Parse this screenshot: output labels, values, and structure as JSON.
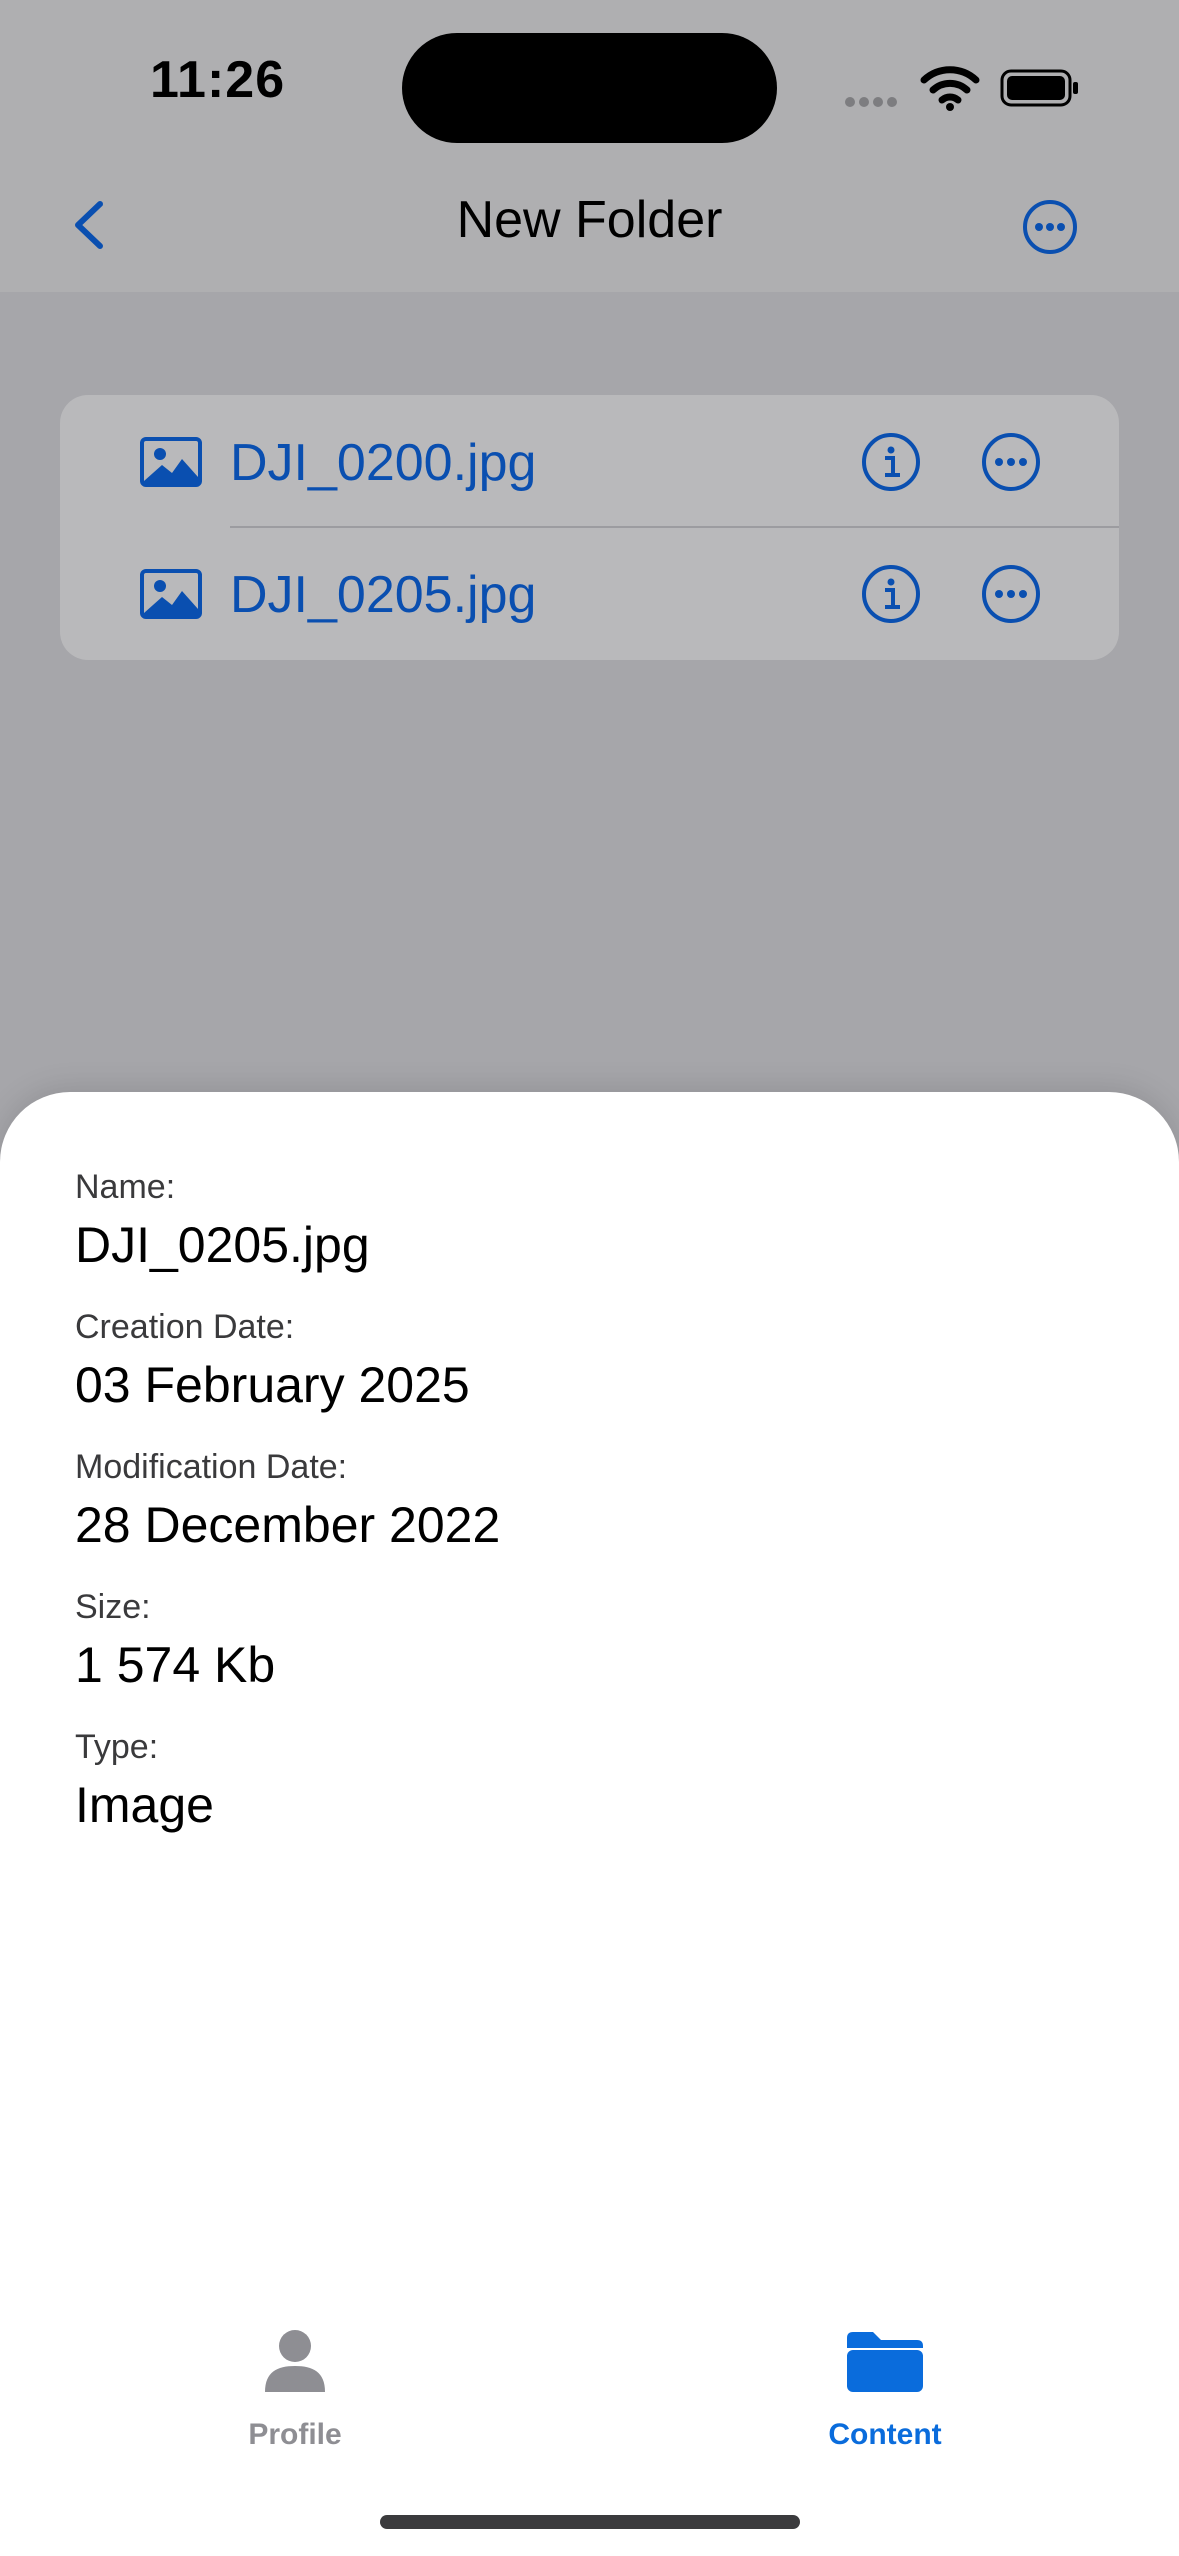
{
  "status_bar": {
    "time": "11:26"
  },
  "nav": {
    "title": "New Folder"
  },
  "files": [
    {
      "name": "DJI_0200.jpg"
    },
    {
      "name": "DJI_0205.jpg"
    }
  ],
  "details": {
    "name_label": "Name:",
    "name_value": "DJI_0205.jpg",
    "creation_label": "Creation Date:",
    "creation_value": "03 February 2025",
    "modification_label": "Modification Date:",
    "modification_value": "28 December 2022",
    "size_label": "Size:",
    "size_value": "1 574 Kb",
    "type_label": "Type:",
    "type_value": "Image"
  },
  "tabs": [
    {
      "label": "Profile",
      "icon": "person-icon",
      "selected": false
    },
    {
      "label": "Content",
      "icon": "folder-icon",
      "selected": true
    }
  ],
  "colors": {
    "accent": "#0A6CDC",
    "dimmed_accent": "#0A4FB0",
    "tab_inactive": "#8E8E93"
  }
}
